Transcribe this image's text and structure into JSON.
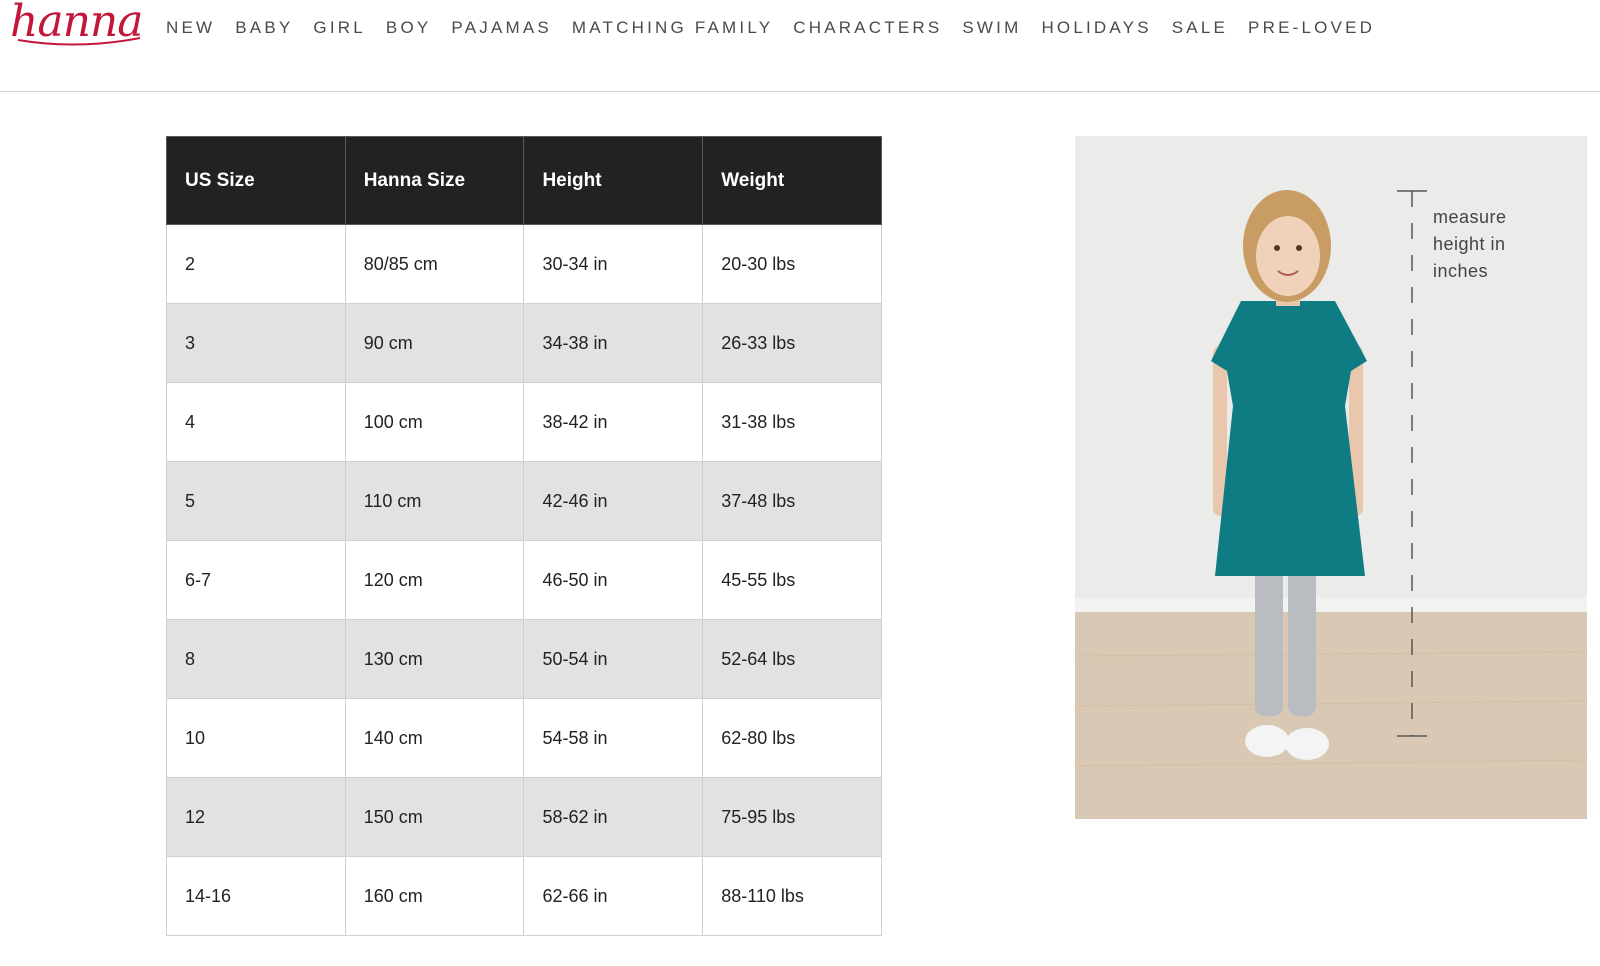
{
  "brand": {
    "name": "hanna",
    "color": "#c3173a"
  },
  "nav": [
    "NEW",
    "BABY",
    "GIRL",
    "BOY",
    "PAJAMAS",
    "MATCHING FAMILY",
    "CHARACTERS",
    "SWIM",
    "HOLIDAYS",
    "SALE",
    "PRE-LOVED"
  ],
  "table": {
    "headers": [
      "US Size",
      "Hanna Size",
      "Height",
      "Weight"
    ],
    "rows": [
      [
        "2",
        "80/85 cm",
        "30-34 in",
        "20-30 lbs"
      ],
      [
        "3",
        "90 cm",
        "34-38 in",
        "26-33 lbs"
      ],
      [
        "4",
        "100 cm",
        "38-42 in",
        "31-38 lbs"
      ],
      [
        "5",
        "110 cm",
        "42-46 in",
        "37-48 lbs"
      ],
      [
        "6-7",
        "120 cm",
        "46-50 in",
        "45-55 lbs"
      ],
      [
        "8",
        "130 cm",
        "50-54 in",
        "52-64 lbs"
      ],
      [
        "10",
        "140 cm",
        "54-58 in",
        "62-80 lbs"
      ],
      [
        "12",
        "150 cm",
        "58-62 in",
        "75-95 lbs"
      ],
      [
        "14-16",
        "160 cm",
        "62-66 in",
        "88-110 lbs"
      ]
    ]
  },
  "photo": {
    "measure_label": "measure\nheight in\ninches"
  },
  "colors": {
    "header_bg": "#222222",
    "alt_row": "#e2e2e2",
    "dress": "#0f7b82"
  }
}
